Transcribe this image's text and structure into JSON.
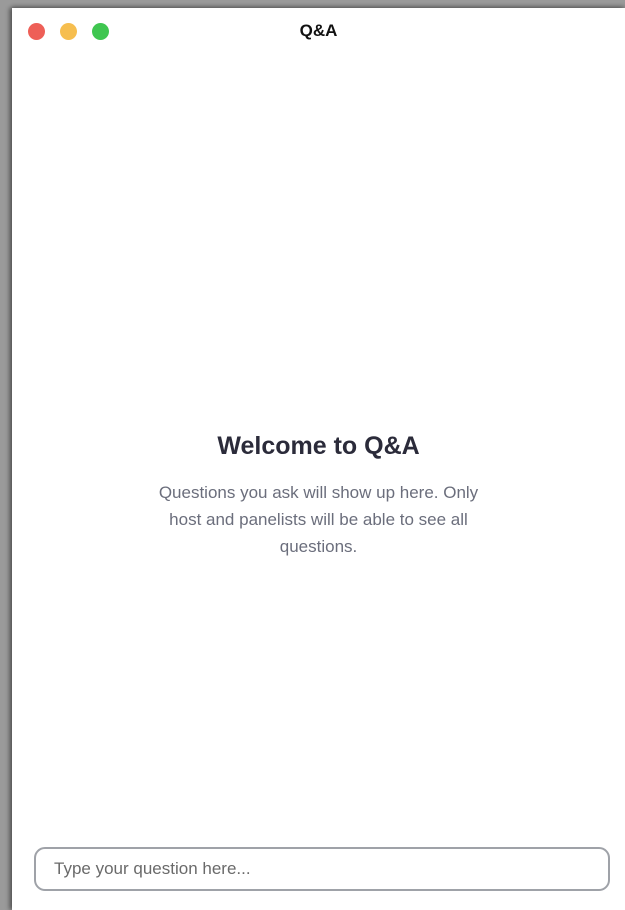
{
  "window": {
    "title": "Q&A",
    "controls": {
      "close_color": "#ee5f57",
      "minimize_color": "#f6be4f",
      "zoom_color": "#3fc650"
    }
  },
  "welcome": {
    "title": "Welcome to Q&A",
    "body": "Questions you ask will show up here. Only host and panelists will be able to see all questions."
  },
  "question_input": {
    "placeholder": "Type your question here...",
    "value": ""
  }
}
